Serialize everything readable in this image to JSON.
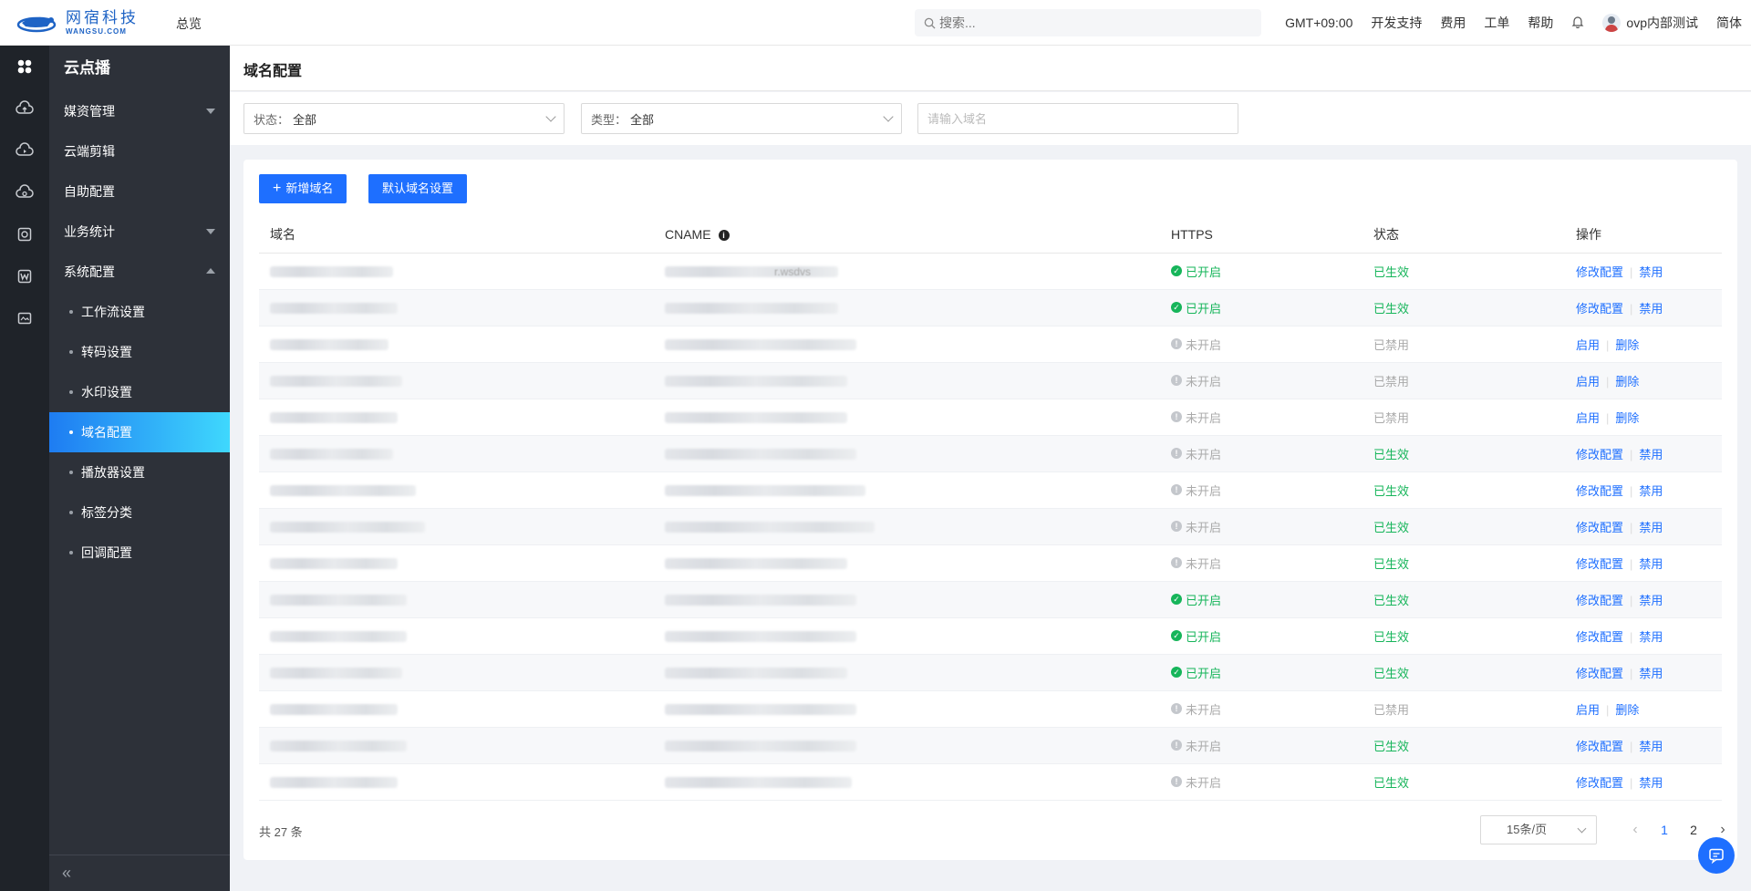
{
  "brand": {
    "cn": "网宿科技",
    "en": "WANGSU.COM"
  },
  "header": {
    "overview": "总览",
    "search_placeholder": "搜索...",
    "timezone": "GMT+09:00",
    "links": [
      "开发支持",
      "费用",
      "工单",
      "帮助"
    ],
    "user": "ovp内部测试",
    "lang": "简体"
  },
  "rail": [
    "grid-icon",
    "cloud-upload-icon",
    "cloud-play-icon",
    "cloud-video-icon",
    "box-icon",
    "w-icon",
    "image-icon"
  ],
  "menu": {
    "title": "云点播",
    "items": [
      {
        "label": "媒资管理",
        "arrow": "down"
      },
      {
        "label": "云端剪辑",
        "arrow": ""
      },
      {
        "label": "自助配置",
        "arrow": ""
      },
      {
        "label": "业务统计",
        "arrow": "down"
      },
      {
        "label": "系统配置",
        "arrow": "up"
      }
    ],
    "sub": [
      "工作流设置",
      "转码设置",
      "水印设置",
      "域名配置",
      "播放器设置",
      "标签分类",
      "回调配置"
    ],
    "active_sub": "域名配置",
    "collapse": "«"
  },
  "page": {
    "title": "域名配置",
    "filters": {
      "status_label": "状态：",
      "status_value": "全部",
      "type_label": "类型：",
      "type_value": "全部",
      "domain_placeholder": "请输入域名"
    },
    "buttons": {
      "add": "新增域名",
      "default": "默认域名设置"
    },
    "columns": [
      "域名",
      "CNAME",
      "HTTPS",
      "状态",
      "操作"
    ],
    "rows": [
      {
        "https": "已开启",
        "https_on": true,
        "status": "已生效",
        "active": true,
        "ops": [
          "修改配置",
          "禁用"
        ],
        "cname_hint": "r.wsdvs"
      },
      {
        "https": "已开启",
        "https_on": true,
        "status": "已生效",
        "active": true,
        "ops": [
          "修改配置",
          "禁用"
        ]
      },
      {
        "https": "未开启",
        "https_on": false,
        "status": "已禁用",
        "active": false,
        "ops": [
          "启用",
          "删除"
        ]
      },
      {
        "https": "未开启",
        "https_on": false,
        "status": "已禁用",
        "active": false,
        "ops": [
          "启用",
          "删除"
        ]
      },
      {
        "https": "未开启",
        "https_on": false,
        "status": "已禁用",
        "active": false,
        "ops": [
          "启用",
          "删除"
        ]
      },
      {
        "https": "未开启",
        "https_on": false,
        "status": "已生效",
        "active": true,
        "ops": [
          "修改配置",
          "禁用"
        ]
      },
      {
        "https": "未开启",
        "https_on": false,
        "status": "已生效",
        "active": true,
        "ops": [
          "修改配置",
          "禁用"
        ]
      },
      {
        "https": "未开启",
        "https_on": false,
        "status": "已生效",
        "active": true,
        "ops": [
          "修改配置",
          "禁用"
        ]
      },
      {
        "https": "未开启",
        "https_on": false,
        "status": "已生效",
        "active": true,
        "ops": [
          "修改配置",
          "禁用"
        ]
      },
      {
        "https": "已开启",
        "https_on": true,
        "status": "已生效",
        "active": true,
        "ops": [
          "修改配置",
          "禁用"
        ]
      },
      {
        "https": "已开启",
        "https_on": true,
        "status": "已生效",
        "active": true,
        "ops": [
          "修改配置",
          "禁用"
        ]
      },
      {
        "https": "已开启",
        "https_on": true,
        "status": "已生效",
        "active": true,
        "ops": [
          "修改配置",
          "禁用"
        ]
      },
      {
        "https": "未开启",
        "https_on": false,
        "status": "已禁用",
        "active": false,
        "ops": [
          "启用",
          "删除"
        ]
      },
      {
        "https": "未开启",
        "https_on": false,
        "status": "已生效",
        "active": true,
        "ops": [
          "修改配置",
          "禁用"
        ]
      },
      {
        "https": "未开启",
        "https_on": false,
        "status": "已生效",
        "active": true,
        "ops": [
          "修改配置",
          "禁用"
        ]
      }
    ],
    "total": "共 27 条",
    "page_size": "15条/页",
    "pages": [
      "1",
      "2"
    ],
    "current_page": "1"
  },
  "colors": {
    "accent": "#1e6fff",
    "success": "#16b55a",
    "disabled": "#aaaaaa"
  }
}
